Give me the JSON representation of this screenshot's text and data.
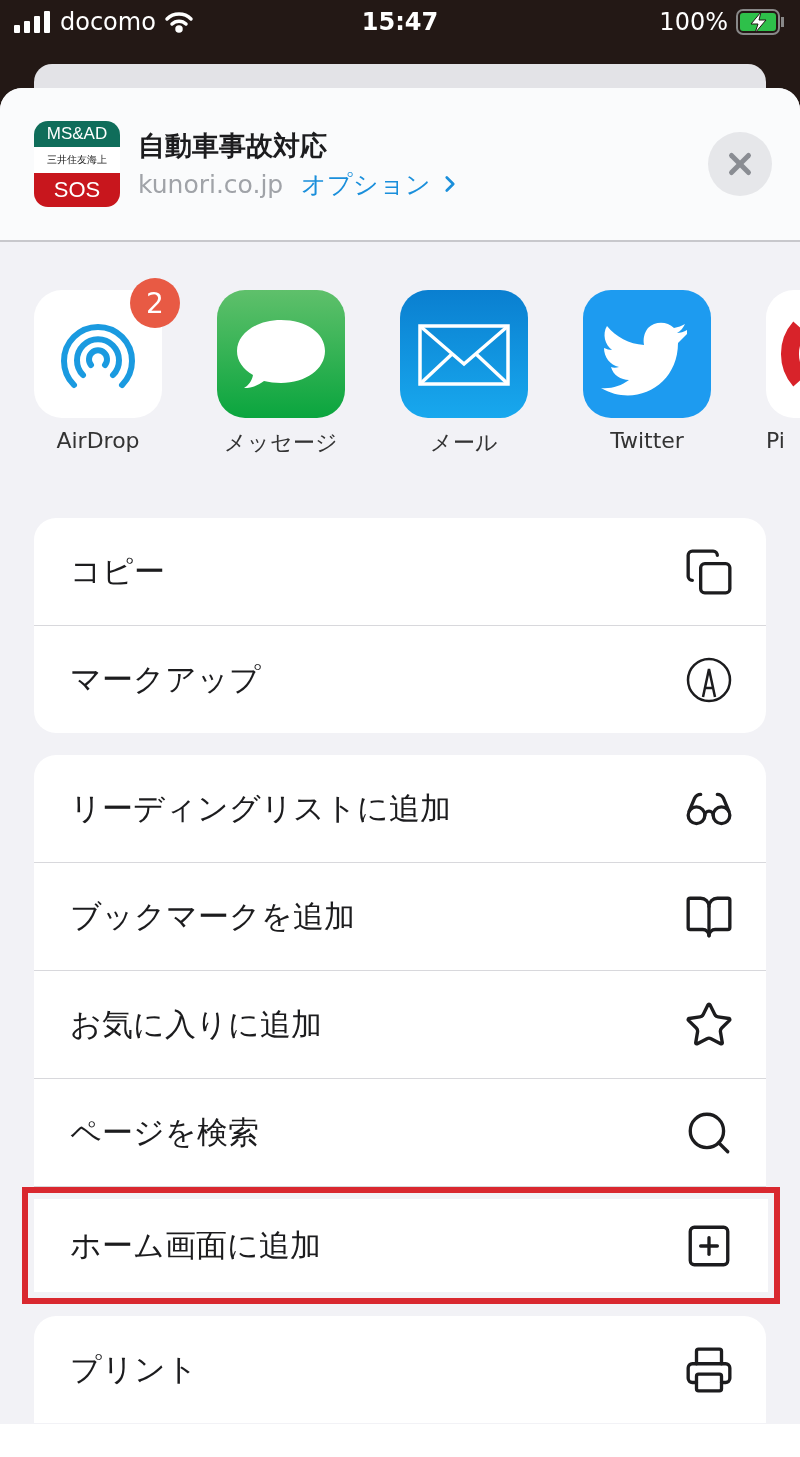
{
  "status_bar": {
    "carrier": "docomo",
    "time": "15:47",
    "battery": "100%"
  },
  "header": {
    "logo": {
      "top": "MS&AD",
      "middle": "三井住友海上",
      "bottom": "SOS"
    },
    "title": "自動車事故対応",
    "domain": "kunori.co.jp",
    "options_link": "オプション"
  },
  "apps": [
    {
      "label": "AirDrop",
      "badge": "2"
    },
    {
      "label": "メッセージ"
    },
    {
      "label": "メール"
    },
    {
      "label": "Twitter"
    },
    {
      "label": "Pi"
    }
  ],
  "action_groups": [
    {
      "items": [
        {
          "label": "コピー",
          "highlighted": false
        },
        {
          "label": "マークアップ",
          "highlighted": false
        }
      ]
    },
    {
      "items": [
        {
          "label": "リーディングリストに追加",
          "highlighted": false
        },
        {
          "label": "ブックマークを追加",
          "highlighted": false
        },
        {
          "label": "お気に入りに追加",
          "highlighted": false
        },
        {
          "label": "ページを検索",
          "highlighted": false
        },
        {
          "label": "ホーム画面に追加",
          "highlighted": true
        }
      ]
    },
    {
      "items": [
        {
          "label": "プリント",
          "highlighted": false
        }
      ]
    }
  ]
}
